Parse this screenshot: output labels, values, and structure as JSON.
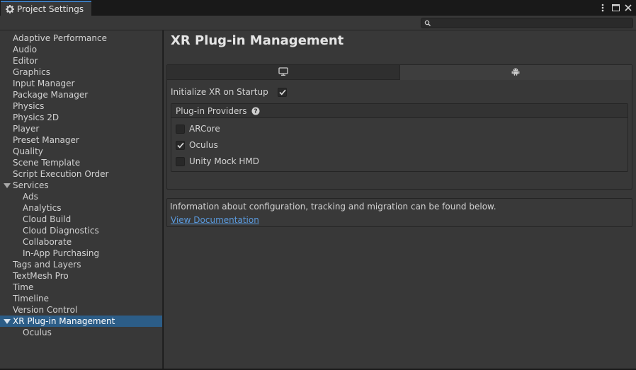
{
  "window": {
    "tab_title": "Project Settings",
    "icons": {
      "tab": "gear-icon",
      "menu": "kebab-menu-icon",
      "maximize": "maximize-icon",
      "close": "close-icon"
    }
  },
  "search": {
    "placeholder": "",
    "value": "",
    "icon": "search-icon"
  },
  "sidebar": {
    "items": [
      {
        "label": "Adaptive Performance"
      },
      {
        "label": "Audio"
      },
      {
        "label": "Editor"
      },
      {
        "label": "Graphics"
      },
      {
        "label": "Input Manager"
      },
      {
        "label": "Package Manager"
      },
      {
        "label": "Physics"
      },
      {
        "label": "Physics 2D"
      },
      {
        "label": "Player"
      },
      {
        "label": "Preset Manager"
      },
      {
        "label": "Quality"
      },
      {
        "label": "Scene Template"
      },
      {
        "label": "Script Execution Order"
      },
      {
        "label": "Services"
      },
      {
        "label": "Ads"
      },
      {
        "label": "Analytics"
      },
      {
        "label": "Cloud Build"
      },
      {
        "label": "Cloud Diagnostics"
      },
      {
        "label": "Collaborate"
      },
      {
        "label": "In-App Purchasing"
      },
      {
        "label": "Tags and Layers"
      },
      {
        "label": "TextMesh Pro"
      },
      {
        "label": "Time"
      },
      {
        "label": "Timeline"
      },
      {
        "label": "Version Control"
      },
      {
        "label": "XR Plug-in Management"
      },
      {
        "label": "Oculus"
      }
    ],
    "selected_label": "XR Plug-in Management"
  },
  "main": {
    "title": "XR Plug-in Management",
    "platform_tabs": [
      {
        "icon": "monitor-icon",
        "active": false
      },
      {
        "icon": "android-icon",
        "active": true
      }
    ],
    "init_label": "Initialize XR on Startup",
    "init_checked": true,
    "providers_header": "Plug-in Providers",
    "providers": [
      {
        "label": "ARCore",
        "checked": false
      },
      {
        "label": "Oculus",
        "checked": true
      },
      {
        "label": "Unity Mock HMD",
        "checked": false
      }
    ],
    "info_text": "Information about configuration, tracking and migration can be found below.",
    "doc_link": "View Documentation"
  },
  "colors": {
    "selection": "#2c5d87",
    "link": "#5b9bdf",
    "panel": "#383838",
    "tab_accent": "#3a79bb"
  }
}
